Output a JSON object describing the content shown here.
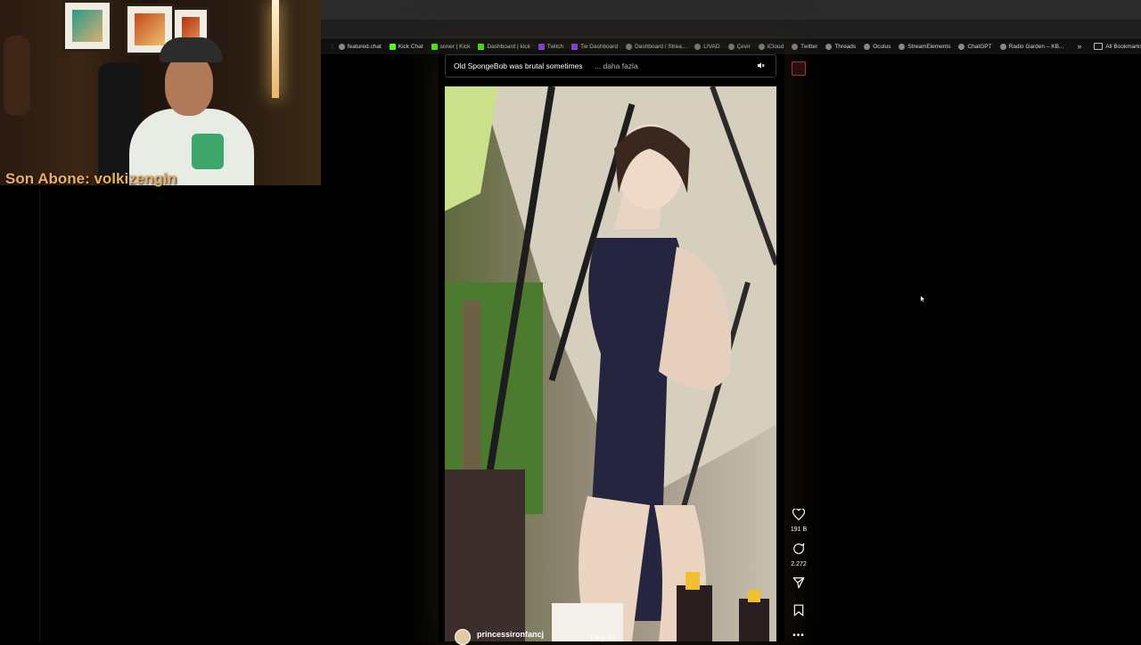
{
  "bookmarks": [
    {
      "label": "featured.chat",
      "icon": "globe-icon"
    },
    {
      "label": "Kick Chat",
      "icon": "kick-icon"
    },
    {
      "label": "soner | Kick",
      "icon": "kick-icon"
    },
    {
      "label": "Dashboard | kick",
      "icon": "kick-icon"
    },
    {
      "label": "Twitch",
      "icon": "twitch-icon"
    },
    {
      "label": "Tw Dashboard",
      "icon": "twitch-icon"
    },
    {
      "label": "Dashboard / Strea...",
      "icon": "globe-icon"
    },
    {
      "label": "LIVAD",
      "icon": "globe-icon"
    },
    {
      "label": "Çevir",
      "icon": "globe-icon"
    },
    {
      "label": "iCloud",
      "icon": "globe-icon"
    },
    {
      "label": "Twitter",
      "icon": "globe-icon"
    },
    {
      "label": "Threads",
      "icon": "globe-icon"
    },
    {
      "label": "Oculus",
      "icon": "globe-icon"
    },
    {
      "label": "StreamElements",
      "icon": "globe-icon"
    },
    {
      "label": "ChatGPT",
      "icon": "globe-icon"
    },
    {
      "label": "Radio Garden – KB...",
      "icon": "globe-icon"
    }
  ],
  "bookmarks_more": "»",
  "all_bookmarks": "All Bookmarks",
  "overlay": {
    "last_sub": "Son Abone: volkizengin"
  },
  "reel": {
    "caption": "Old SpongeBob was brutal sometimes",
    "more_label": "... daha fazla",
    "mute_icon": "muted-speaker-icon",
    "username": "princessironfancj",
    "follow_label": "Takip Et",
    "likes": "191 B",
    "comments": "2.272"
  },
  "colors": {
    "sub_label": "#e8b060",
    "kick": "#53fc18",
    "twitch": "#9146ff"
  }
}
